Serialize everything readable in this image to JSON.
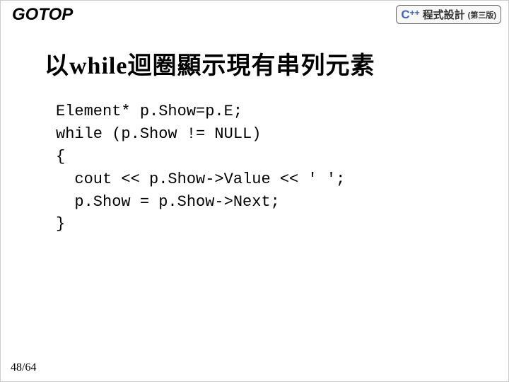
{
  "header": {
    "logo_left": "GOTOP",
    "cpp_text": "C",
    "cpp_plus": "++",
    "book_title": "程式設計",
    "book_edition": "(第三版)"
  },
  "title": "以while迴圈顯示現有串列元素",
  "code": {
    "line1": "Element* p.Show=p.E;",
    "line2": "while (p.Show != NULL)",
    "line3": "{",
    "line4": "  cout << p.Show->Value << ' ';",
    "line5": "  p.Show = p.Show->Next;",
    "line6": "}"
  },
  "page_number": "48/64"
}
